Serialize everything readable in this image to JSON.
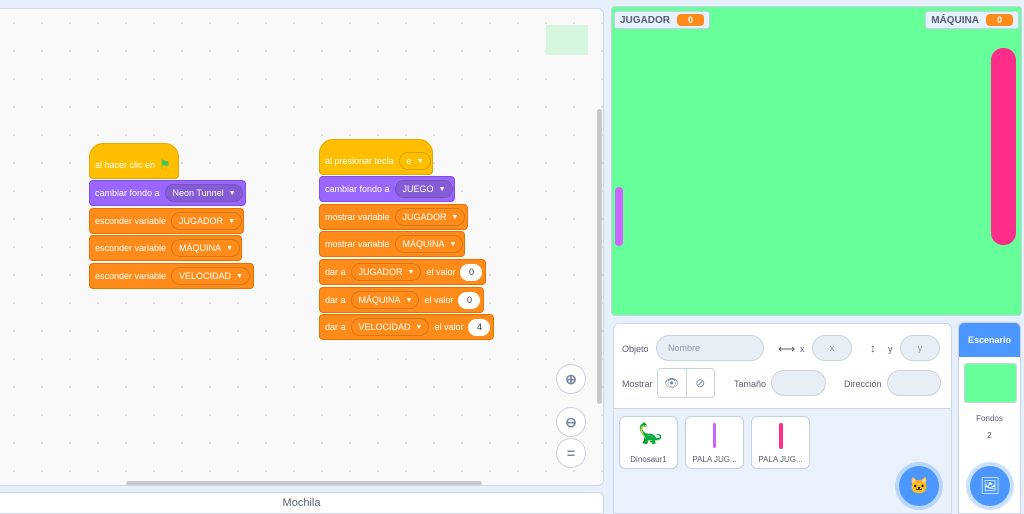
{
  "scripts": {
    "left": {
      "hat_label": "al hacer clic en",
      "b1_label": "cambiar fondo a",
      "b1_value": "Neon Tunnel",
      "b2_label": "esconder variable",
      "b2_value": "JUGADOR",
      "b3_label": "esconder variable",
      "b3_value": "MÁQUINA",
      "b4_label": "esconder variable",
      "b4_value": "VELOCIDAD"
    },
    "right": {
      "hat_label": "al presionar tecla",
      "hat_value": "e",
      "b1_label": "cambiar fondo a",
      "b1_value": "JUEGO",
      "b2_label": "mostrar variable",
      "b2_value": "JUGADOR",
      "b3_label": "mostrar variable",
      "b3_value": "MÁQUINA",
      "set_prefix": "dar a",
      "set_mid": "el valor",
      "s1_var": "JUGADOR",
      "s1_val": "0",
      "s2_var": "MÁQUINA",
      "s2_val": "0",
      "s3_var": "VELOCIDAD",
      "s3_val": "4"
    }
  },
  "zoom": {
    "in_icon": "zoom-in-icon",
    "out_icon": "zoom-out-icon",
    "reset_icon": "zoom-reset-icon"
  },
  "mochila": {
    "label": "Mochila"
  },
  "stage": {
    "background": "#66ff99",
    "monitor_left_label": "JUGADOR",
    "monitor_left_value": "0",
    "monitor_right_label": "MÁQUINA",
    "monitor_right_value": "0",
    "paddle_left_color": "#cc66ff",
    "paddle_right_color": "#ff2d8a"
  },
  "sprite_info": {
    "objeto_label": "Objeto",
    "name_placeholder": "Nombre",
    "x_label": "x",
    "x_placeholder": "x",
    "y_label": "y",
    "y_placeholder": "y",
    "mostrar_label": "Mostrar",
    "tamano_label": "Tamaño",
    "direccion_label": "Dirección"
  },
  "sprites": [
    {
      "name": "Dinosaur1"
    },
    {
      "name": "PALA JUG..."
    },
    {
      "name": "PALA JUG..."
    }
  ],
  "escenario": {
    "title": "Escenario",
    "fondos_label": "Fondos",
    "fondos_count": "2"
  }
}
